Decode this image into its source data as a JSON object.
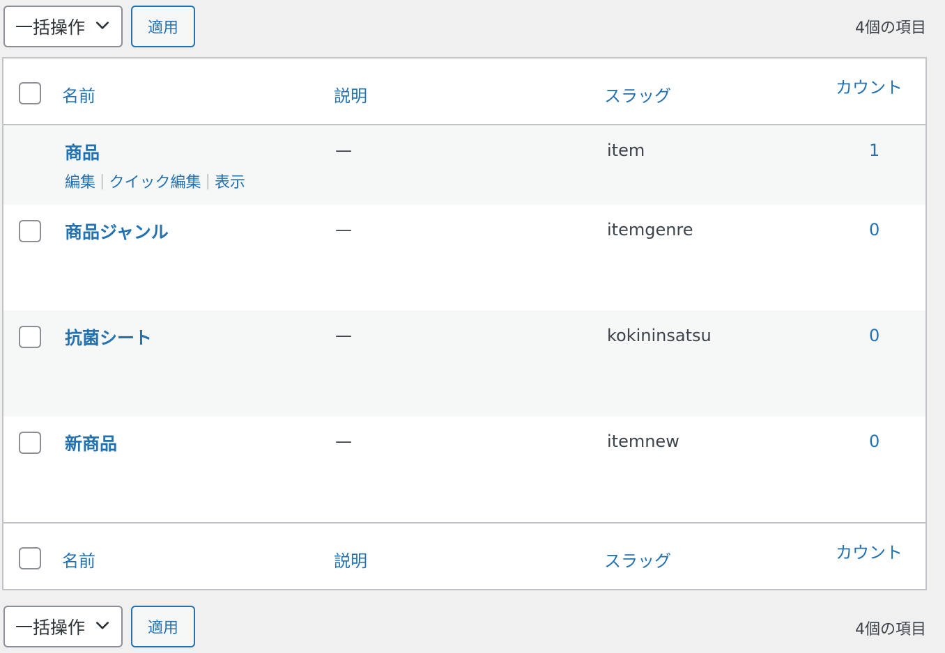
{
  "bulk_actions": {
    "label": "一括操作",
    "apply_label": "適用"
  },
  "item_count": "4個の項目",
  "columns": {
    "name": "名前",
    "description": "説明",
    "slug": "スラッグ",
    "count": "カウント"
  },
  "rows": [
    {
      "name": "商品",
      "description": "—",
      "slug": "item",
      "count": "1",
      "actions": {
        "edit": "編集",
        "quick_edit": "クイック編集",
        "view": "表示"
      }
    },
    {
      "name": "商品ジャンル",
      "description": "—",
      "slug": "itemgenre",
      "count": "0"
    },
    {
      "name": "抗菌シート",
      "description": "—",
      "slug": "kokininsatsu",
      "count": "0"
    },
    {
      "name": "新商品",
      "description": "—",
      "slug": "itemnew",
      "count": "0"
    }
  ],
  "icons": {
    "dropdown": "chevron-down-icon"
  },
  "colors": {
    "link": "#2271b1",
    "border": "#c3c4c7",
    "background": "#f0f0f1"
  }
}
